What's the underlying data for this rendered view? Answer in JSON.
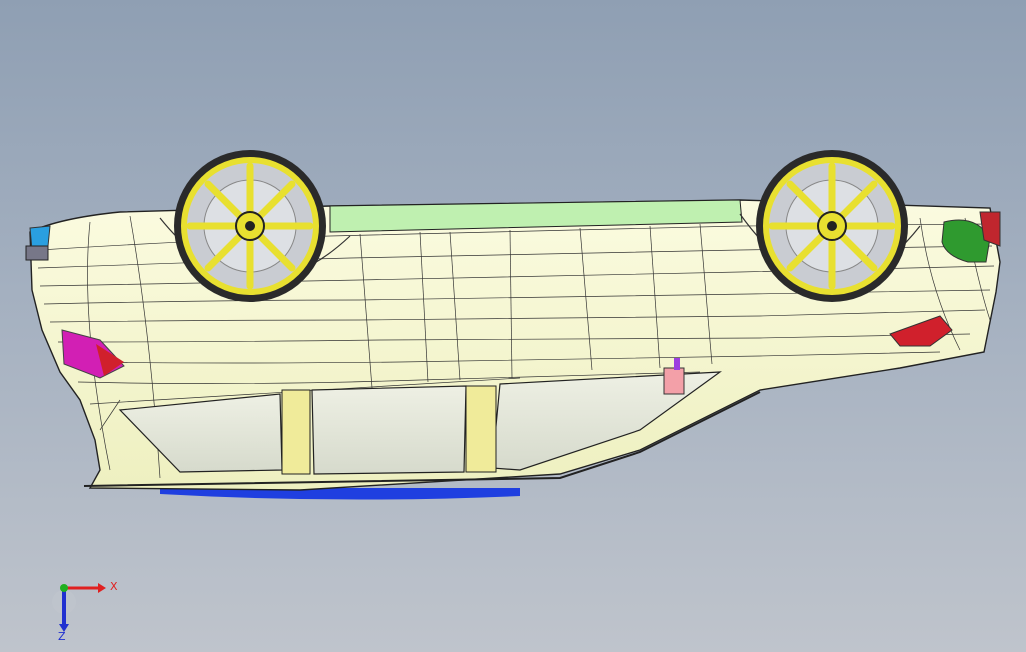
{
  "viewport": {
    "background_top": "#8f9fb3",
    "background_bottom": "#bfc4cc"
  },
  "model": {
    "body_color": "#f7f8d2",
    "panel_green": "#bff0b0",
    "window_color": "#e3e6d8",
    "rocker_color": "#f0eb9a",
    "wheel_rim": "#e8e030",
    "tire": "#2a2a2a",
    "underside_blue": "#1f3fe0",
    "tail_light": "#d0202c",
    "head_light_accent": "#d21fb4",
    "icon": "car-model-icon"
  },
  "triad": {
    "x_label": "X",
    "z_label": "Z",
    "x_color": "#e02020",
    "y_color": "#20b020",
    "z_color": "#2030d0"
  }
}
